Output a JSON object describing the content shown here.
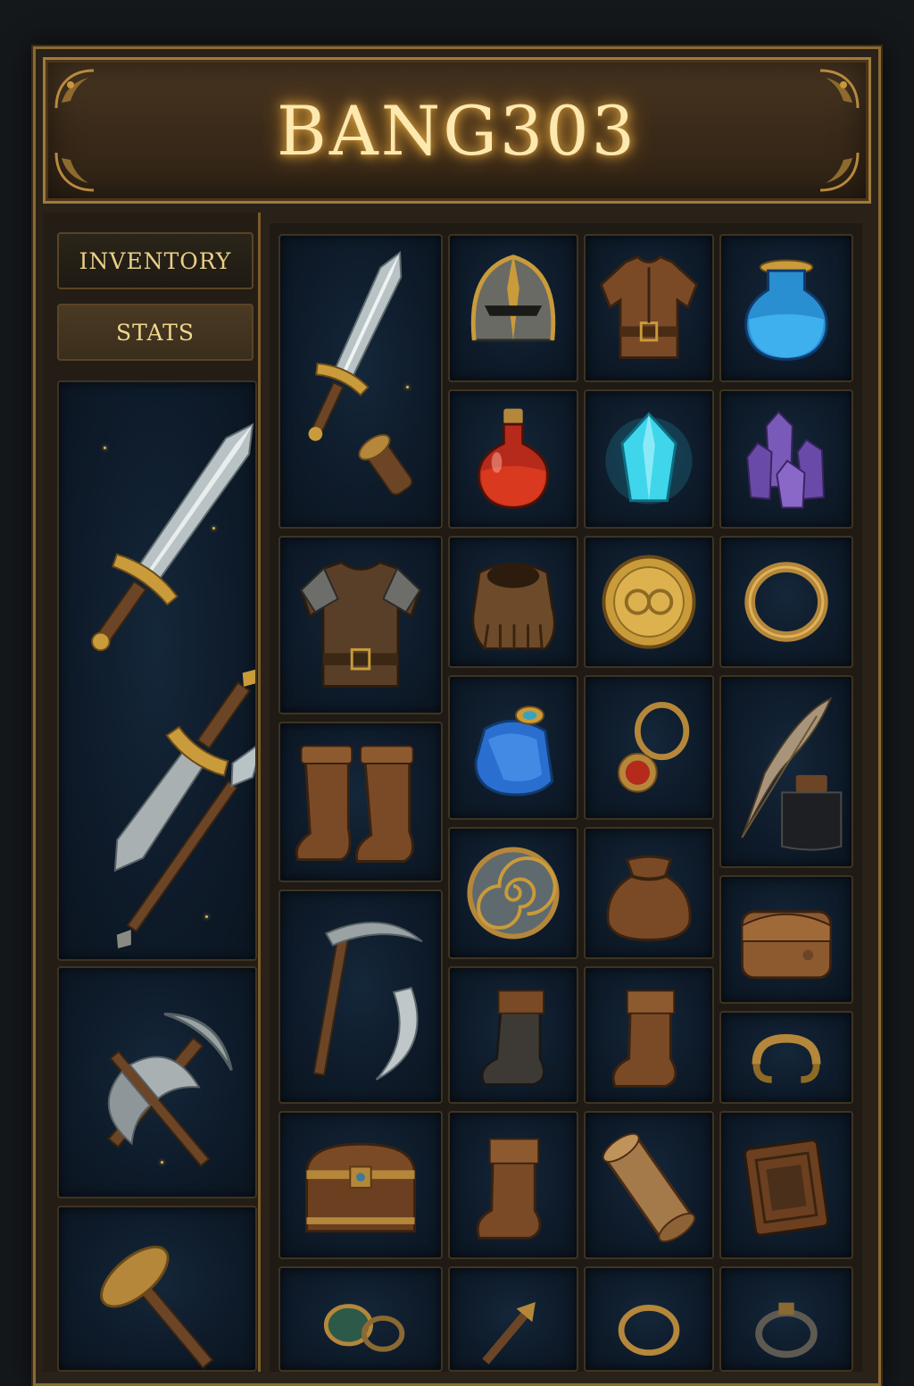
{
  "title": "BANG303",
  "tabs": [
    {
      "id": "inventory",
      "label": "INVENTORY"
    },
    {
      "id": "stats",
      "label": "STATS"
    }
  ],
  "colors": {
    "gold": "#c9963a",
    "title_glow": "#f5b94a",
    "slot_bg": "#0e1b2a",
    "frame": "#8a6a32"
  },
  "sidebar_items": [
    {
      "name": "weapon-set-sword-dagger-spear",
      "icons": [
        "sword-icon",
        "dagger-icon",
        "spear-icon"
      ]
    },
    {
      "name": "weapon-set-pickaxe-axe",
      "icons": [
        "pickaxe-icon",
        "battle-axe-icon"
      ]
    },
    {
      "name": "weapon-set-mallet",
      "icons": [
        "mallet-icon"
      ]
    }
  ],
  "grid_items": [
    {
      "name": "sword-and-hilt",
      "icons": [
        "sword-icon",
        "hilt-icon"
      ]
    },
    {
      "name": "helmet",
      "icons": [
        "helmet-icon"
      ]
    },
    {
      "name": "leather-tunic",
      "icons": [
        "tunic-icon"
      ]
    },
    {
      "name": "blue-potion",
      "icons": [
        "blue-potion-icon"
      ]
    },
    {
      "name": "red-potion",
      "icons": [
        "red-potion-icon"
      ]
    },
    {
      "name": "cyan-crystal",
      "icons": [
        "crystal-icon"
      ]
    },
    {
      "name": "amethyst-cluster",
      "icons": [
        "amethyst-icon"
      ]
    },
    {
      "name": "chest-armor",
      "icons": [
        "chest-armor-icon"
      ]
    },
    {
      "name": "gauntlet",
      "icons": [
        "gauntlet-icon"
      ]
    },
    {
      "name": "gold-coin",
      "icons": [
        "gold-coin-icon"
      ]
    },
    {
      "name": "gold-ring",
      "icons": [
        "ring-icon"
      ]
    },
    {
      "name": "mana-flask",
      "icons": [
        "mana-flask-icon"
      ]
    },
    {
      "name": "ruby-ring",
      "icons": [
        "ruby-ring-icon"
      ]
    },
    {
      "name": "quill-and-ink",
      "icons": [
        "quill-icon",
        "ink-bottle-icon"
      ]
    },
    {
      "name": "leather-boots",
      "icons": [
        "boots-icon"
      ]
    },
    {
      "name": "spiral-shield",
      "icons": [
        "spiral-shield-icon"
      ]
    },
    {
      "name": "coin-pouch",
      "icons": [
        "pouch-icon"
      ]
    },
    {
      "name": "satchel",
      "icons": [
        "satchel-icon"
      ]
    },
    {
      "name": "pickaxe-and-sickle",
      "icons": [
        "pickaxe-icon",
        "sickle-icon"
      ]
    },
    {
      "name": "dark-boot",
      "icons": [
        "boot-icon"
      ]
    },
    {
      "name": "brown-boot",
      "icons": [
        "boot-icon"
      ]
    },
    {
      "name": "bracelet",
      "icons": [
        "bracelet-icon"
      ]
    },
    {
      "name": "treasure-chest",
      "icons": [
        "treasure-chest-icon"
      ]
    },
    {
      "name": "boot-3",
      "icons": [
        "boot-icon"
      ]
    },
    {
      "name": "scroll",
      "icons": [
        "scroll-icon"
      ]
    },
    {
      "name": "leather-tome",
      "icons": [
        "tome-icon"
      ]
    },
    {
      "name": "emerald-amulet",
      "icons": [
        "amulet-icon"
      ]
    },
    {
      "name": "torch",
      "icons": [
        "torch-icon"
      ]
    },
    {
      "name": "bronze-ring",
      "icons": [
        "ring-icon"
      ]
    },
    {
      "name": "iron-ring",
      "icons": [
        "ring-icon"
      ]
    }
  ]
}
